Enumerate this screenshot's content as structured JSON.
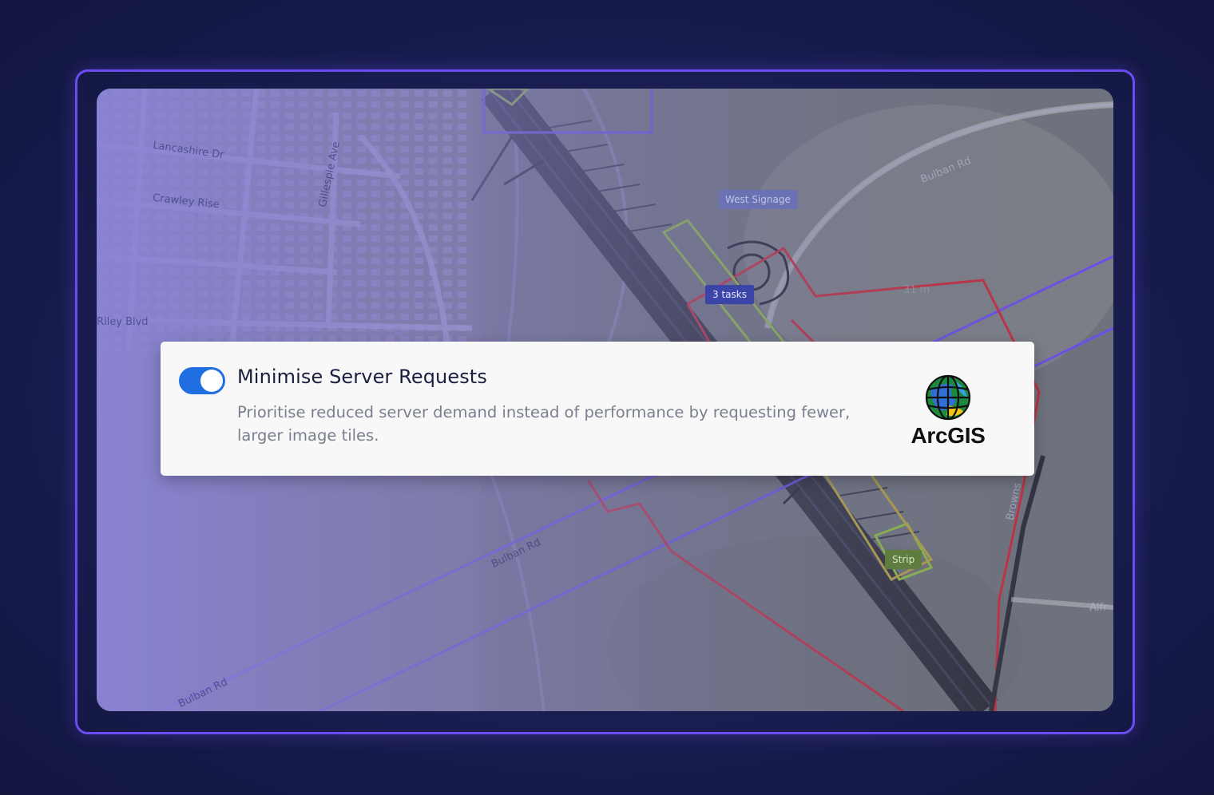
{
  "map": {
    "labels": {
      "west_signage": "West Signage",
      "tasks": "3 tasks",
      "strip": "Strip"
    },
    "streets": {
      "lancashire": "Lancashire Dr",
      "crawley": "Crawley Rise",
      "gillespie": "Gillespie Ave",
      "bulban_top": "Bulban Rd",
      "bulban_mid": "Bulban Rd",
      "bulban_bottom": "Bulban Rd",
      "browns": "Browns",
      "alfred": "Alfr",
      "riley": "Riley Blvd",
      "elevation": "31 m"
    }
  },
  "setting": {
    "toggle_state": "on",
    "title": "Minimise Server Requests",
    "description": "Prioritise reduced server demand instead of performance by requesting fewer, larger image tiles.",
    "logo_text": "ArcGIS"
  },
  "colors": {
    "toggle_on": "#1f6fe0",
    "frame_border": "#6b4cf0",
    "boundary_red": "#c8283a",
    "boundary_purple": "#6b4cf0",
    "zone_green": "#8fbf3f"
  },
  "icons": {
    "logo": "arcgis-globe-icon"
  }
}
